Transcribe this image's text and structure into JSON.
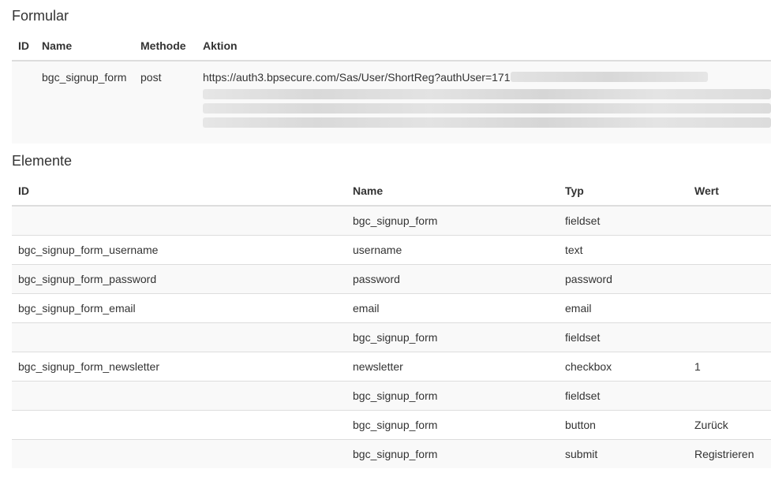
{
  "formular": {
    "title": "Formular",
    "headers": {
      "id": "ID",
      "name": "Name",
      "method": "Methode",
      "action": "Aktion"
    },
    "row": {
      "id": "",
      "name": "bgc_signup_form",
      "method": "post",
      "action": "https://auth3.bpsecure.com/Sas/User/ShortReg?authUser=171"
    }
  },
  "elemente": {
    "title": "Elemente",
    "headers": {
      "id": "ID",
      "name": "Name",
      "type": "Typ",
      "value": "Wert"
    },
    "rows": [
      {
        "id": "",
        "name": "bgc_signup_form",
        "type": "fieldset",
        "value": ""
      },
      {
        "id": "bgc_signup_form_username",
        "name": "username",
        "type": "text",
        "value": ""
      },
      {
        "id": "bgc_signup_form_password",
        "name": "password",
        "type": "password",
        "value": ""
      },
      {
        "id": "bgc_signup_form_email",
        "name": "email",
        "type": "email",
        "value": ""
      },
      {
        "id": "",
        "name": "bgc_signup_form",
        "type": "fieldset",
        "value": ""
      },
      {
        "id": "bgc_signup_form_newsletter",
        "name": "newsletter",
        "type": "checkbox",
        "value": "1"
      },
      {
        "id": "",
        "name": "bgc_signup_form",
        "type": "fieldset",
        "value": ""
      },
      {
        "id": "",
        "name": "bgc_signup_form",
        "type": "button",
        "value": "Zurück"
      },
      {
        "id": "",
        "name": "bgc_signup_form",
        "type": "submit",
        "value": "Registrieren"
      }
    ]
  }
}
